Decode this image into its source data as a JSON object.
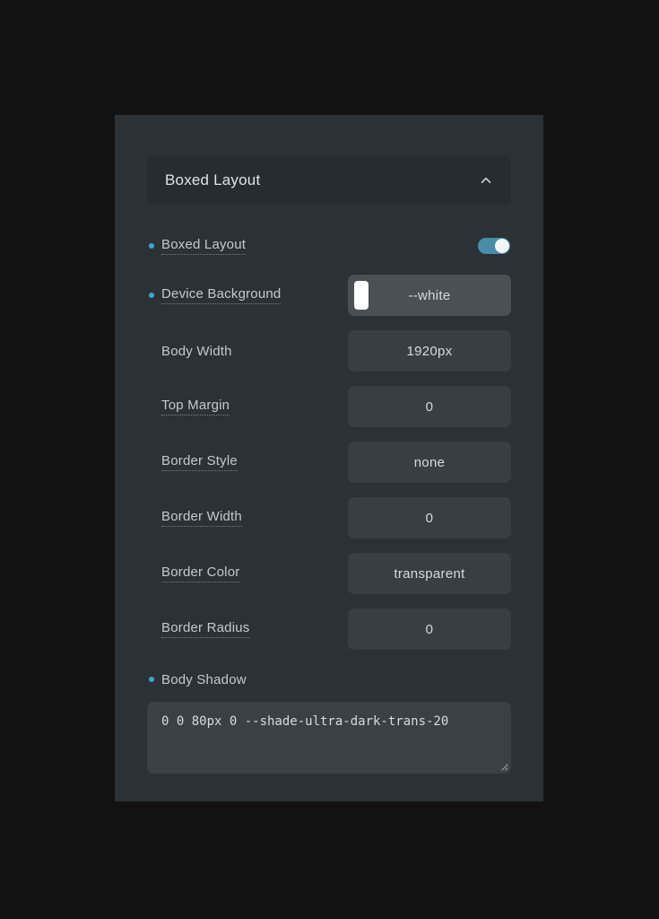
{
  "panel": {
    "accordion": {
      "title": "Boxed Layout",
      "chevron_icon": "chevron-up-icon",
      "expanded": true
    },
    "accent_color": "#3ba7d6",
    "panel_bg": "#2b3236",
    "page_bg": "#121212",
    "field_bg": "#383f44",
    "toggle_on_color": "#4a8da8",
    "rows": [
      {
        "label": "Boxed Layout",
        "bullet": true,
        "dotted_underline": true,
        "control": "toggle",
        "value": "on"
      },
      {
        "label": "Device Background",
        "bullet": true,
        "dotted_underline": true,
        "control": "color-input",
        "value": "--white",
        "swatch_color": "#ffffff"
      },
      {
        "label": "Body Width",
        "bullet": false,
        "dotted_underline": false,
        "control": "text-input",
        "value": "1920px"
      },
      {
        "label": "Top Margin",
        "bullet": false,
        "dotted_underline": true,
        "control": "text-input",
        "value": "0"
      },
      {
        "label": "Border Style",
        "bullet": false,
        "dotted_underline": true,
        "control": "text-input",
        "value": "none"
      },
      {
        "label": "Border Width",
        "bullet": false,
        "dotted_underline": true,
        "control": "text-input",
        "value": "0"
      },
      {
        "label": "Border Color",
        "bullet": false,
        "dotted_underline": true,
        "control": "text-input",
        "value": "transparent"
      },
      {
        "label": "Border Radius",
        "bullet": false,
        "dotted_underline": true,
        "control": "text-input",
        "value": "0"
      }
    ],
    "shadow": {
      "label": "Body Shadow",
      "bullet": true,
      "dotted_underline": false,
      "value": "0 0 80px 0 --shade-ultra-dark-trans-20"
    }
  }
}
